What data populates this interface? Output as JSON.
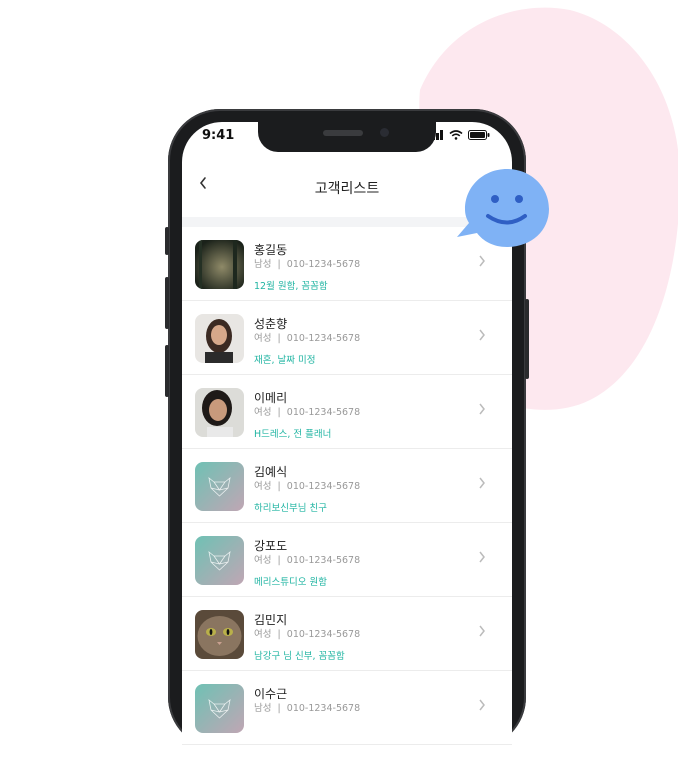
{
  "status_bar": {
    "time": "9:41"
  },
  "header": {
    "title": "고객리스트",
    "back_icon": "chevron-left-icon"
  },
  "customers": [
    {
      "name": "홍길동",
      "gender": "남성",
      "phone": "010-1234-5678",
      "note": "12월 원함, 꼼꼼함",
      "avatar": "photo-forest"
    },
    {
      "name": "성춘향",
      "gender": "여성",
      "phone": "010-1234-5678",
      "note": "재혼, 날짜 미정",
      "avatar": "photo-woman-1"
    },
    {
      "name": "이메리",
      "gender": "여성",
      "phone": "010-1234-5678",
      "note": "H드레스, 전 플래너",
      "avatar": "photo-woman-2"
    },
    {
      "name": "김예식",
      "gender": "여성",
      "phone": "010-1234-5678",
      "note": "하리보신부님 친구",
      "avatar": "fox-placeholder"
    },
    {
      "name": "강포도",
      "gender": "여성",
      "phone": "010-1234-5678",
      "note": "메리스튜디오 원함",
      "avatar": "fox-placeholder"
    },
    {
      "name": "김민지",
      "gender": "여성",
      "phone": "010-1234-5678",
      "note": "남강구 님 신부, 꼼꼼함",
      "avatar": "photo-cat"
    },
    {
      "name": "이수근",
      "gender": "남성",
      "phone": "010-1234-5678",
      "note": "",
      "avatar": "fox-placeholder"
    }
  ],
  "separator": "|",
  "colors": {
    "accent": "#22b5a3",
    "bubble": "#7fb2f5",
    "blob": "#fde8ef"
  }
}
